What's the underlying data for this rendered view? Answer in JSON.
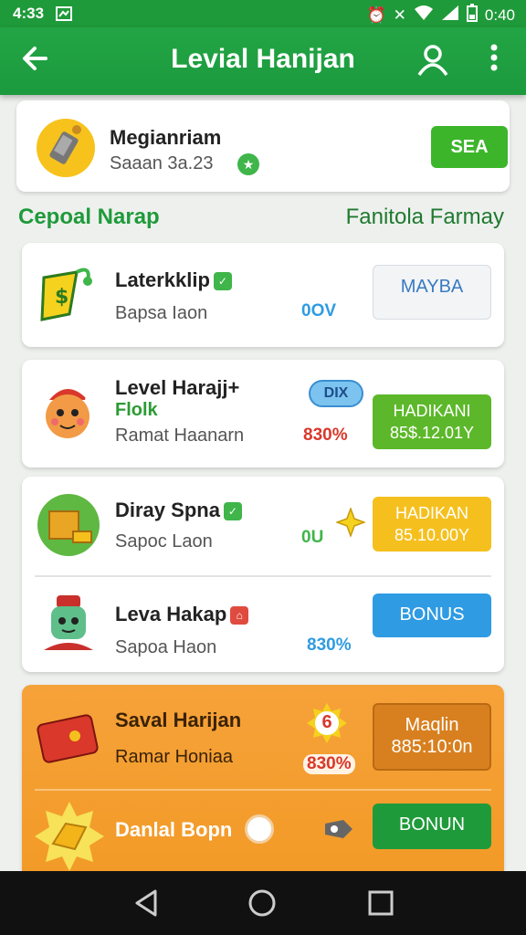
{
  "status_bar": {
    "time": "4:33",
    "clock": "0:40"
  },
  "app_bar": {
    "title": "Levial Hanijan"
  },
  "top_card": {
    "name": "Megianriam",
    "sub": "Saaan 3a.23",
    "button": "SEA"
  },
  "section": {
    "left": "Cepoal Narap",
    "right": "Fanitola Farmay"
  },
  "cards": [
    {
      "name": "Laterkklip",
      "sub": "Bapsa Iaon",
      "stat": "0OV",
      "button": "MAYBA",
      "button_color": "#f2f4f6"
    },
    {
      "name": "Level Harajj+",
      "extra": "Flolk",
      "sub": "Ramat Haanarn",
      "pill": "DIX",
      "stat": "830%",
      "button_l1": "HADIKANI",
      "button_l2": "85$.12.01Y",
      "button_color": "#5cb82a"
    },
    {
      "name": "Diray Spna",
      "sub": "Sapoc Laon",
      "stat": "0U",
      "button_l1": "HADIKAN",
      "button_l2": "85.10.00Y",
      "button_color": "#f5c01e"
    },
    {
      "name": "Leva Hakap",
      "sub": "Sapoa Haon",
      "stat": "830%",
      "button": "BONUS",
      "button_color": "#2f9be2"
    },
    {
      "name": "Saval Harijan",
      "sub": "Ramar Honiaa",
      "badge": "6",
      "stat": "830%",
      "button_l1": "Maqlin",
      "button_l2": "885:10:0n",
      "button_color": "#d8801f"
    },
    {
      "name": "Danlal Bopn",
      "button": "BONUN",
      "button_color": "#1f9a3a"
    }
  ],
  "colors": {
    "primary": "#1f9a3a",
    "accent": "#3cb52b",
    "orange": "#f29a26"
  }
}
